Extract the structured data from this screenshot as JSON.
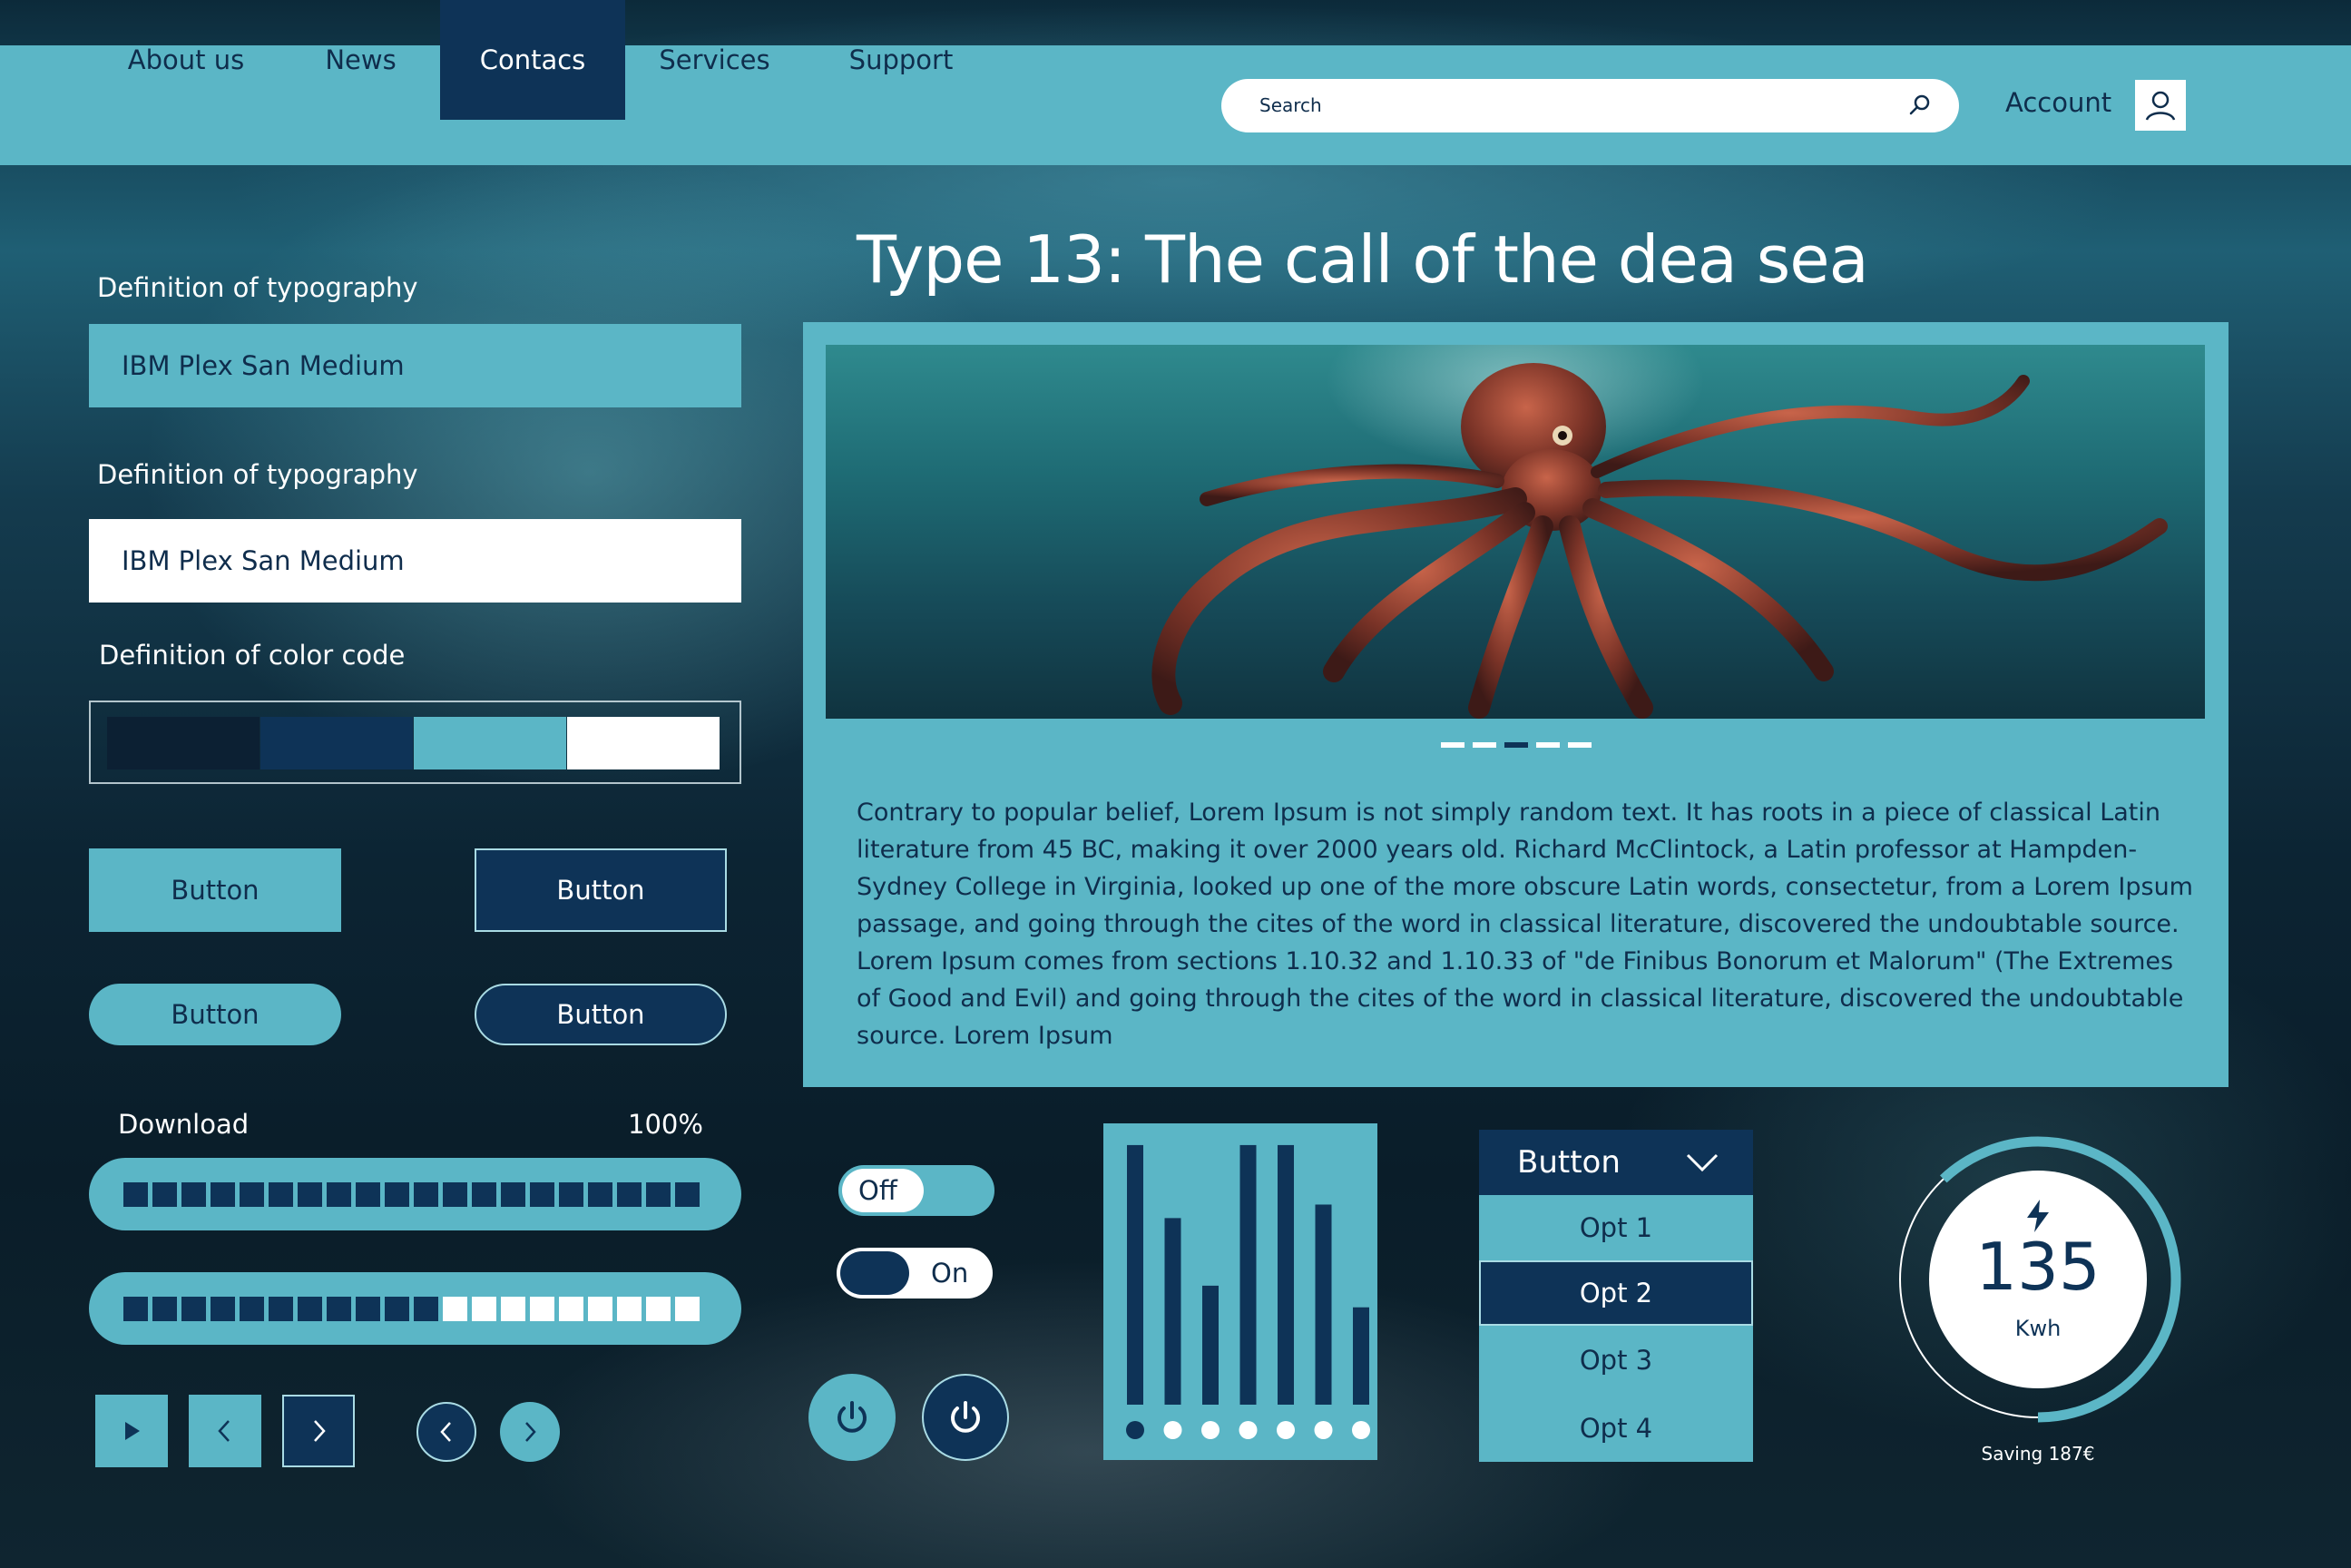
{
  "nav": {
    "items": [
      {
        "label": "About us"
      },
      {
        "label": "News"
      },
      {
        "label": "Contacs"
      },
      {
        "label": "Services"
      },
      {
        "label": "Support"
      }
    ],
    "active_index": 2,
    "search_placeholder": "Search",
    "account_label": "Account"
  },
  "left": {
    "typography_label_1": "Definition of typography",
    "typography_value_1": "IBM Plex San Medium",
    "typography_label_2": "Definition of typography",
    "typography_value_2": "IBM Plex San Medium",
    "color_code_label": "Definition of color code",
    "swatches": [
      "#0c2033",
      "#0e3357",
      "#5bb6c6",
      "#ffffff"
    ],
    "buttons": [
      "Button",
      "Button",
      "Button",
      "Button"
    ],
    "download_label": "Download",
    "download_percent": "100%",
    "progress_1_fraction": 1.0,
    "progress_2_fraction": 0.55
  },
  "main": {
    "title": "Type 13: The call of the dea sea",
    "carousel_active_index": 2,
    "carousel_count": 5,
    "body": "Contrary to popular belief, Lorem Ipsum is not simply random text. It has roots in a piece of classical Latin literature from 45 BC, making it over 2000 years old. Richard McClintock, a Latin professor at Hampden-Sydney College in Virginia, looked up one of the more obscure Latin words, consectetur, from a Lorem Ipsum passage, and going through the cites of the word in classical literature, discovered the undoubtable source. Lorem Ipsum comes from sections 1.10.32 and 1.10.33 of \"de Finibus Bonorum et Malorum\" (The Extremes of Good and Evil) and going through the cites of the word in classical literature, discovered the undoubtable source. Lorem Ipsum"
  },
  "toggles": {
    "off_label": "Off",
    "on_label": "On"
  },
  "chart_data": {
    "type": "bar",
    "values": [
      0.96,
      0.69,
      0.44,
      0.96,
      0.96,
      0.74,
      0.36
    ],
    "ylim": [
      0,
      1
    ],
    "active_index": 0
  },
  "dropdown": {
    "label": "Button",
    "options": [
      "Opt 1",
      "Opt 2",
      "Opt 3",
      "Opt 4"
    ],
    "selected_index": 1
  },
  "gauge": {
    "value": "135",
    "unit": "Kwh",
    "fraction": 0.62,
    "saving": "Saving 187€",
    "icon": "bolt-icon"
  },
  "colors": {
    "accent": "#5bb6c6",
    "dark": "#0e3357",
    "text_dark": "#0f2d4c"
  }
}
